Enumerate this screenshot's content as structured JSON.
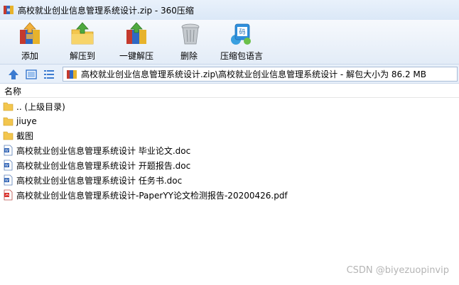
{
  "window": {
    "title": "高校就业创业信息管理系统设计.zip - 360压缩"
  },
  "toolbar": {
    "add": "添加",
    "extract_to": "解压到",
    "one_click_extract": "一键解压",
    "delete": "删除",
    "language": "压缩包语言"
  },
  "address": {
    "path": "高校就业创业信息管理系统设计.zip\\高校就业创业信息管理系统设计 - 解包大小为 86.2 MB"
  },
  "list": {
    "header_name": "名称",
    "items": [
      {
        "name": ".. (上级目录)",
        "type": "folder"
      },
      {
        "name": "jiuye",
        "type": "folder"
      },
      {
        "name": "截图",
        "type": "folder"
      },
      {
        "name": "高校就业创业信息管理系统设计 毕业论文.doc",
        "type": "doc"
      },
      {
        "name": "高校就业创业信息管理系统设计 开题报告.doc",
        "type": "doc"
      },
      {
        "name": "高校就业创业信息管理系统设计 任务书.doc",
        "type": "doc"
      },
      {
        "name": "高校就业创业信息管理系统设计-PaperYY论文检测报告-20200426.pdf",
        "type": "pdf"
      }
    ]
  },
  "watermark": "CSDN @biyezuopinvip",
  "colors": {
    "folder": "#f3c64e",
    "doc_blue": "#2b5fb3",
    "pdf_red": "#d9302b",
    "accent": "#3c7bd0"
  }
}
